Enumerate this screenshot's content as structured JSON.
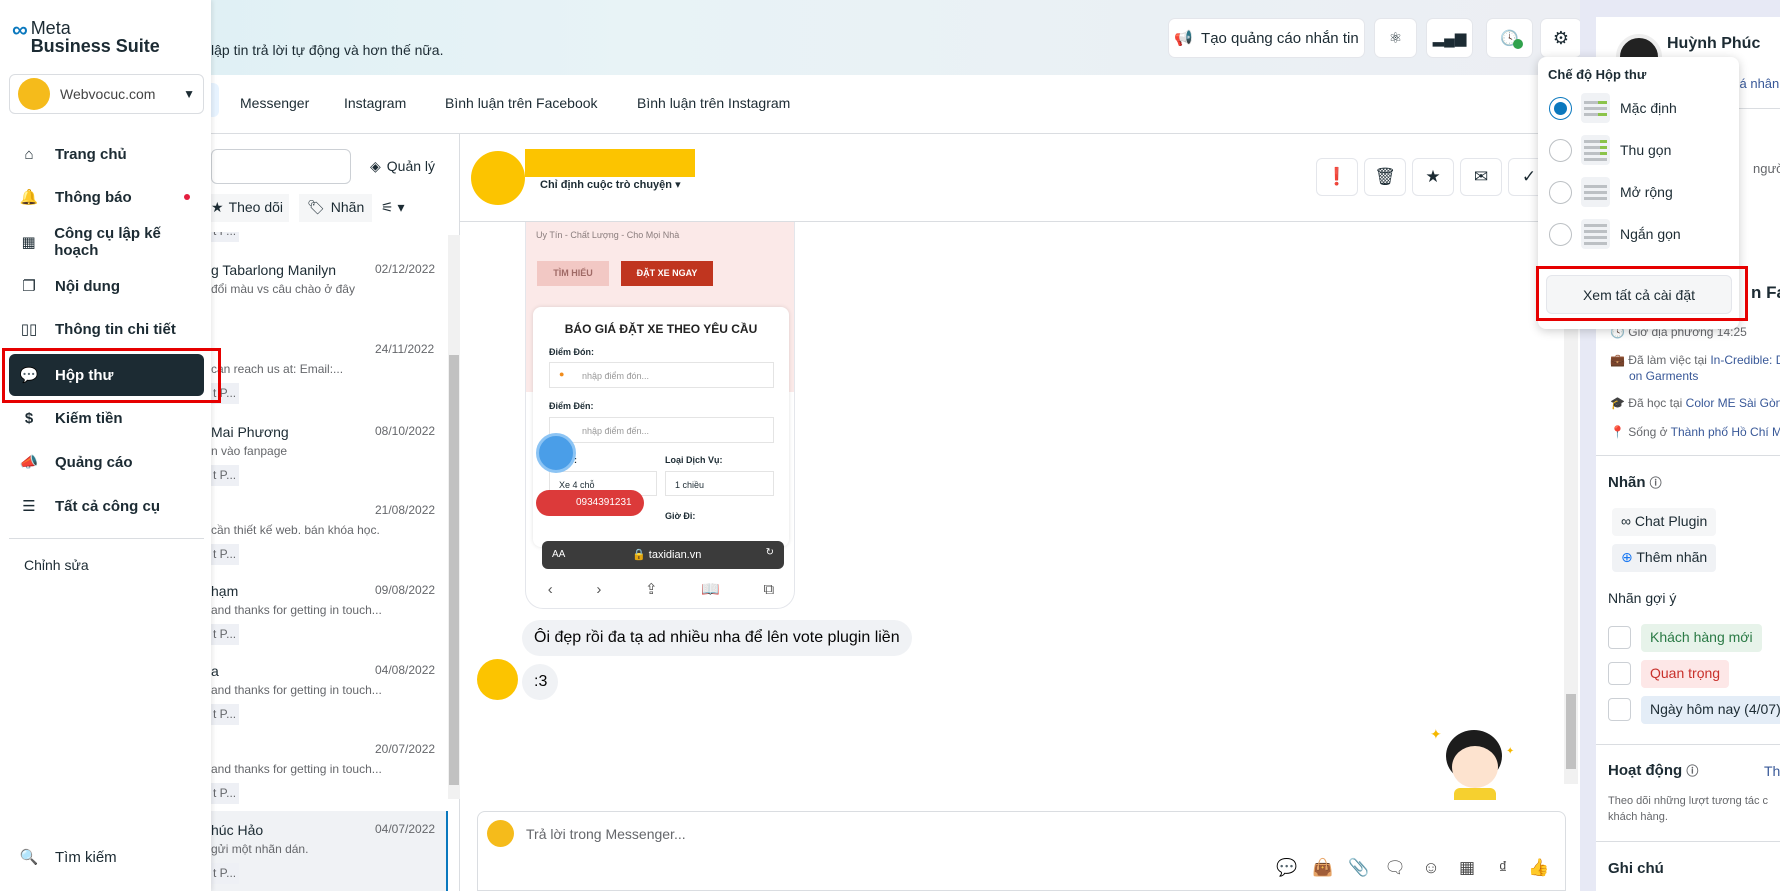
{
  "brand": {
    "line1": "Meta",
    "line2": "Business Suite"
  },
  "account": {
    "name": "Webvocuc.com"
  },
  "sidebar": {
    "items": [
      {
        "label": "Trang chủ",
        "icon": "home-icon"
      },
      {
        "label": "Thông báo",
        "icon": "bell-icon"
      },
      {
        "label": "Công cụ lập kế hoạch",
        "icon": "calendar-icon"
      },
      {
        "label": "Nội dung",
        "icon": "content-icon"
      },
      {
        "label": "Thông tin chi tiết",
        "icon": "bar-chart-icon"
      },
      {
        "label": "Hộp thư",
        "icon": "chat-bubble-icon",
        "active": true
      },
      {
        "label": "Kiếm tiền",
        "icon": "dollar-icon"
      },
      {
        "label": "Quảng cáo",
        "icon": "megaphone-icon"
      },
      {
        "label": "Tất cả công cụ",
        "icon": "menu-icon"
      }
    ],
    "edit": "Chỉnh sửa",
    "search": "Tìm kiếm"
  },
  "banner": {
    "text": "lập tin trả lời tự động và hơn thế nữa."
  },
  "toolbar": {
    "create_ad": "Tạo quảng cáo nhắn tin"
  },
  "tabs": [
    "Messenger",
    "Instagram",
    "Bình luận trên Facebook",
    "Bình luận trên Instagram"
  ],
  "list": {
    "manage": "Quản lý",
    "filter_follow": "Theo dõi",
    "filter_label": "Nhãn",
    "chip": "t P...",
    "items": [
      {
        "name": "g Tabarlong Manilyn",
        "date": "02/12/2022",
        "preview": "đổi màu vs câu chào ở đây"
      },
      {
        "name": "",
        "date": "24/11/2022",
        "preview": "can reach us at: Email:..."
      },
      {
        "name": "Mai Phương",
        "date": "08/10/2022",
        "preview": "n vào fanpage"
      },
      {
        "name": "",
        "date": "21/08/2022",
        "preview": "cần thiết kế web. bán khóa học."
      },
      {
        "name": "hạm",
        "date": "09/08/2022",
        "preview": "and thanks for getting in touch..."
      },
      {
        "name": "a",
        "date": "04/08/2022",
        "preview": "and thanks for getting in touch..."
      },
      {
        "name": "",
        "date": "20/07/2022",
        "preview": "and thanks for getting in touch..."
      },
      {
        "name": "húc Hảo",
        "date": "04/07/2022",
        "preview": "gửi một nhãn dán.",
        "selected": true
      }
    ]
  },
  "chat": {
    "assign": "Chỉ định cuộc trò chuyện",
    "shared_image": {
      "slogan": "Uy Tín - Chất Lượng - Cho Mọi Nhà",
      "btn1": "TÌM HIỂU",
      "btn2": "ĐẶT XE NGAY",
      "form_title": "BÁO GIÁ ĐẶT XE THEO YÊU CẦU",
      "pickup": "Điểm Đón:",
      "pickup_ph": "nhập điểm đón...",
      "dest": "Điểm Đến:",
      "dest_ph": "nhập điểm đến...",
      "car": "Xe:",
      "service": "Loại Dịch Vụ:",
      "car_val": "Xe 4 chỗ",
      "service_val": "1 chiều",
      "phone": "0934391231",
      "time": "Giờ Đi:",
      "url_aa": "AA",
      "url": "taxidian.vn"
    },
    "messages": [
      "Ôi đẹp rồi đa tạ ad nhiều nha để lên vote plugin liền",
      ":3"
    ],
    "composer_placeholder": "Trả lời trong Messenger..."
  },
  "dropdown": {
    "title": "Chế độ Hộp thư",
    "options": [
      "Mặc định",
      "Thu gọn",
      "Mở rộng",
      "Ngắn gọn"
    ],
    "selected": 0,
    "settings": "Xem tất cả cài đặt"
  },
  "profile": {
    "name": "Huỳnh Phúc",
    "link": "cá nhân",
    "snippet": "người,",
    "section": "n Face",
    "local_time": "Giờ địa phương 14:25",
    "work_prefix": "Đã làm việc tại",
    "work": "In-Credible: D",
    "work2": "on Garments",
    "study_prefix": "Đã học tại",
    "study": "Color ME Sài Gòn",
    "live_prefix": "Sống ở",
    "live": "Thành phố Hồ Chí M",
    "labels_title": "Nhãn",
    "label_chat_plugin": "Chat Plugin",
    "add_label": "Thêm nhãn",
    "suggested": "Nhãn gợi ý",
    "suggested_tags": [
      "Khách hàng mới",
      "Quan trọng",
      "Ngày hôm nay (4/07)"
    ],
    "activity_title": "Hoạt động",
    "activity_link": "Th",
    "activity_desc1": "Theo dõi những lượt tương tác c",
    "activity_desc2": "khách hàng.",
    "notes_title": "Ghi chú"
  },
  "colors": {
    "accent": "#0a78be",
    "active_nav": "#1c2b33",
    "highlight": "#e60000",
    "redaction": "#fcc400"
  }
}
